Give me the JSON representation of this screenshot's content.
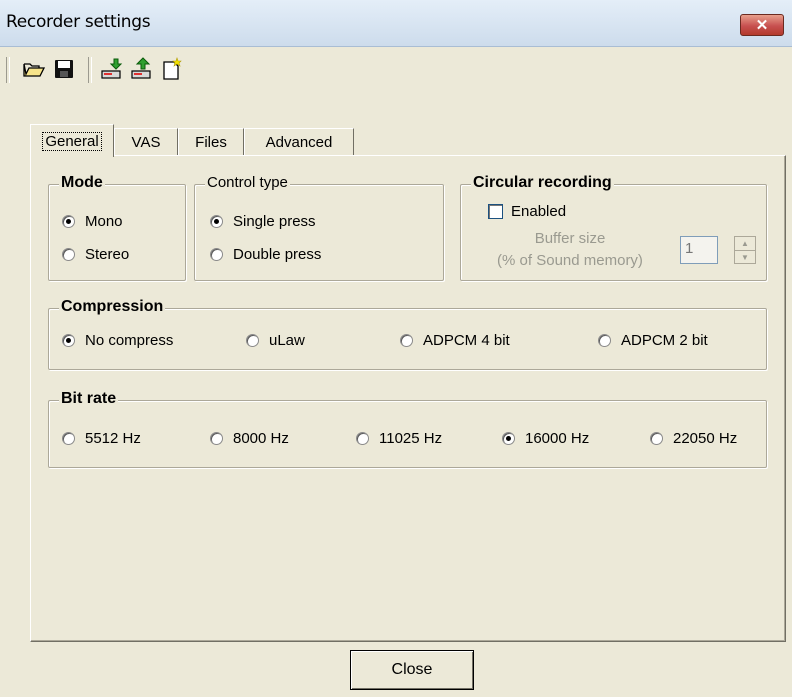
{
  "window": {
    "title": "Recorder settings",
    "close_glyph": "✕"
  },
  "toolbar": {
    "icons": [
      "open-folder-icon",
      "save-icon",
      "download-icon",
      "upload-icon",
      "new-document-icon"
    ]
  },
  "tabs": [
    {
      "label": "General",
      "active": true
    },
    {
      "label": "VAS",
      "active": false
    },
    {
      "label": "Files",
      "active": false
    },
    {
      "label": "Advanced",
      "active": false
    }
  ],
  "mode": {
    "label": "Mode",
    "options": [
      "Mono",
      "Stereo"
    ],
    "selected": "Mono"
  },
  "control_type": {
    "label": "Control type",
    "options": [
      "Single press",
      "Double press"
    ],
    "selected": "Single press"
  },
  "circular": {
    "label": "Circular recording",
    "enabled_label": "Enabled",
    "enabled": false,
    "buffer_label_1": "Buffer size",
    "buffer_label_2": "(% of Sound memory)",
    "buffer_value": "1"
  },
  "compression": {
    "label": "Compression",
    "options": [
      "No compress",
      "uLaw",
      "ADPCM 4 bit",
      "ADPCM 2 bit"
    ],
    "selected": "No compress"
  },
  "bitrate": {
    "label": "Bit rate",
    "options": [
      "5512 Hz",
      "8000 Hz",
      "11025 Hz",
      "16000 Hz",
      "22050 Hz"
    ],
    "selected": "16000 Hz"
  },
  "footer": {
    "close_label": "Close"
  }
}
